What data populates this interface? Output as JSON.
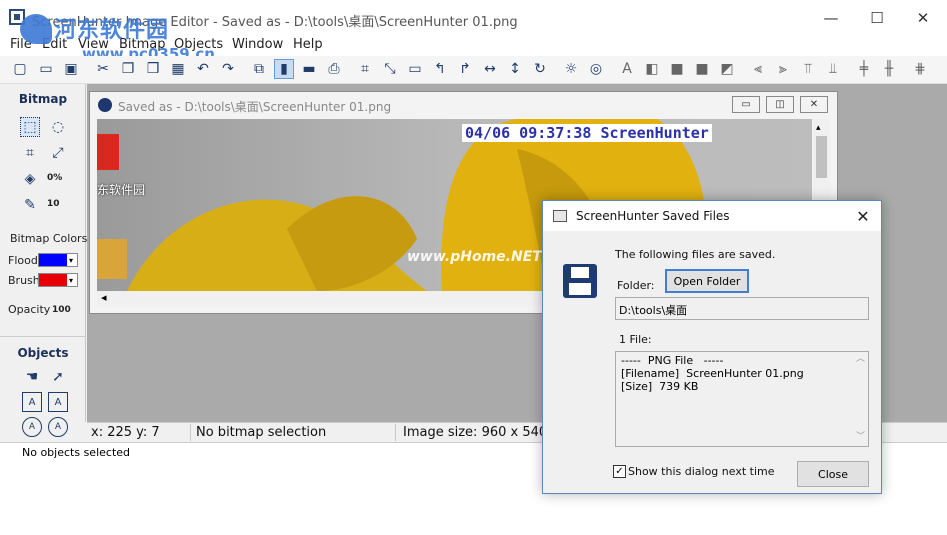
{
  "window": {
    "title": "ScreenHunter Image Editor - Saved as - D:\\tools\\桌面\\ScreenHunter 01.png",
    "minimize": "—",
    "maximize": "☐",
    "close": "✕"
  },
  "watermark": {
    "text": "河东软件园",
    "url": "www.pc0359.cn"
  },
  "menu": [
    "File",
    "Edit",
    "View",
    "Bitmap",
    "Objects",
    "Window",
    "Help"
  ],
  "toolbar_icons": [
    "new-icon",
    "open-icon",
    "save-icon",
    "cut-icon",
    "copy-icon",
    "paste-icon",
    "select-all-icon",
    "undo-icon",
    "redo-icon",
    "capture-icon",
    "vertical-layout-icon",
    "horizontal-layout-icon",
    "print-icon",
    "crop-icon",
    "resize-icon",
    "frame-icon",
    "undo-arrow-icon",
    "redo-arrow-icon",
    "flip-horizontal-icon",
    "flip-vertical-icon",
    "rotate-icon",
    "brightness-icon",
    "color-wheel-icon",
    "text-tool-icon",
    "group-icon",
    "object-small-icon",
    "object-medium-icon",
    "object-large-icon",
    "align-left-icon",
    "align-right-icon",
    "align-top-icon",
    "align-bottom-icon",
    "align-center-icon",
    "align-middle-icon",
    "distribute-icon"
  ],
  "left_panel": {
    "bitmap_header": "Bitmap",
    "zoom_label": "0%",
    "size_label": "10",
    "bitmap_colors": "Bitmap Colors",
    "flood_label": "Flood",
    "brush_label": "Brush",
    "flood_color": "#0000ff",
    "brush_color": "#e80000",
    "opacity_label": "Opacity",
    "opacity_value": "100",
    "objects_header": "Objects"
  },
  "child_window": {
    "title": "Saved as - D:\\tools\\桌面\\ScreenHunter 01.png",
    "stamp": "04/06  09:37:38  ScreenHunter",
    "desktop_label": "东软件园",
    "canvas_watermark": "www.pHome.NET"
  },
  "status": {
    "coords": "x: 225 y: 7",
    "selection": "No bitmap selection",
    "image_size": "Image size: 960 x 540 px"
  },
  "objects_status": "No objects selected",
  "dialog": {
    "title": "ScreenHunter Saved Files",
    "message": "The following files are saved.",
    "folder_label": "Folder:",
    "open_folder": "Open Folder",
    "folder_path": "D:\\tools\\桌面",
    "file_count": "1 File:",
    "files_text": "-----  PNG File   -----\n[Filename]  ScreenHunter 01.png\n[Size]  739 KB",
    "checkbox_label": "Show this dialog next time",
    "checkbox_checked": true,
    "close_button": "Close"
  }
}
